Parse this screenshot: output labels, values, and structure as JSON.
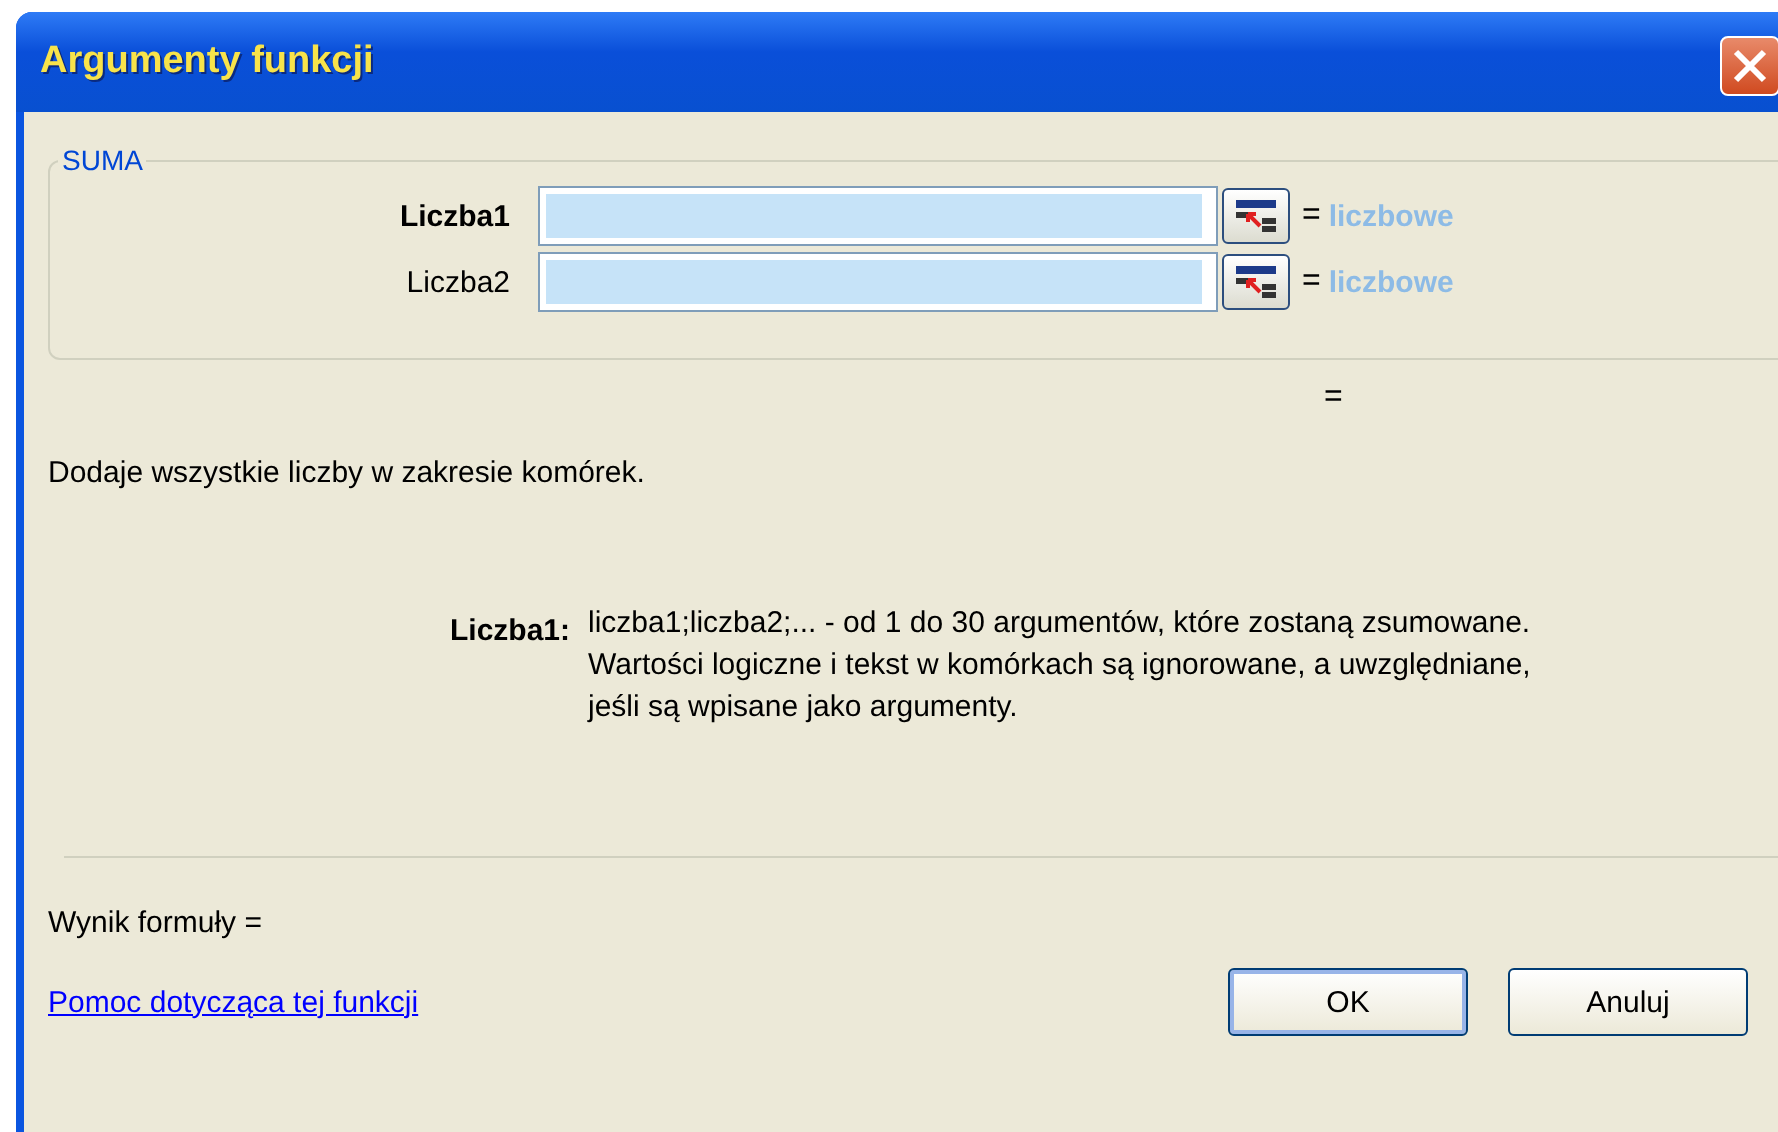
{
  "window": {
    "title": "Argumenty funkcji"
  },
  "function_group": {
    "name": "SUMA",
    "arguments": [
      {
        "label": "Liczba1",
        "selected": true,
        "equals": "=",
        "type_hint": "liczbowe"
      },
      {
        "label": "Liczba2",
        "selected": false,
        "equals": "=",
        "type_hint": "liczbowe"
      }
    ],
    "result": "="
  },
  "description": "Dodaje wszystkie liczby w zakresie komórek.",
  "argument_help": {
    "label": "Liczba1:",
    "lines": [
      "liczba1;liczba2;... - od 1 do 30 argumentów, które zostaną zsumowane.",
      "Wartości logiczne i tekst w komórkach są ignorowane, a uwzględniane,",
      "jeśli są wpisane jako argumenty."
    ]
  },
  "formula_result": "Wynik formuły =",
  "help_link": "Pomoc dotycząca tej funkcji",
  "buttons": [
    {
      "label": "OK",
      "kind": "default"
    },
    {
      "label": "Anuluj",
      "kind": "normal"
    }
  ]
}
